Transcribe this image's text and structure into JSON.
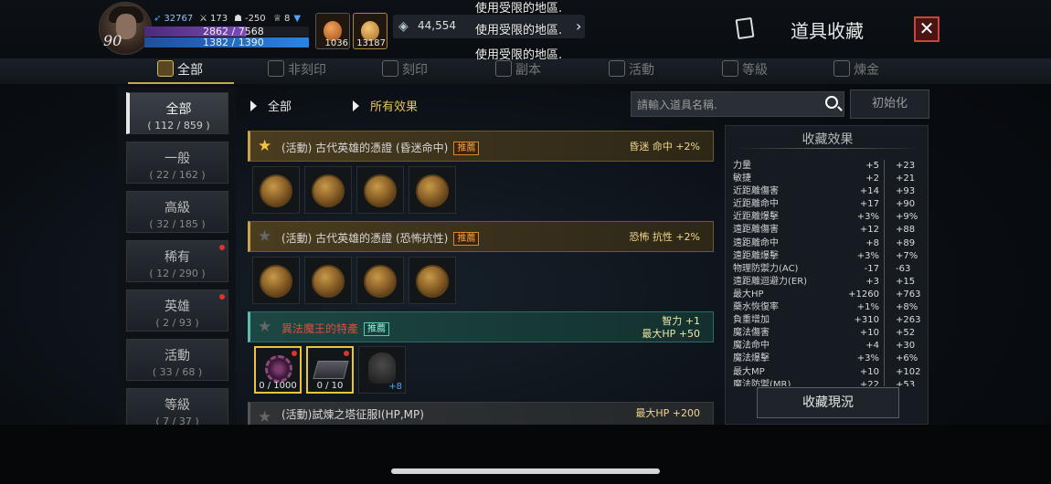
{
  "player": {
    "level": "90",
    "stat_a": "32767",
    "stat_b": "173",
    "stat_c": "-250",
    "stat_d": "8",
    "hp": "2862 / 7568",
    "mp": "1382 / 1390",
    "hp_fill": 0.378,
    "mp_fill": 0.994,
    "potion_count": "1036",
    "food_count": "13187",
    "currency": "44,554"
  },
  "restricted_messages": [
    "使用受限的地區.",
    "使用受限的地區.",
    "使用受限的地區."
  ],
  "window": {
    "title": "道具收藏",
    "close": "✕"
  },
  "tabs": [
    {
      "label": "全部",
      "active": true
    },
    {
      "label": "非刻印",
      "active": false
    },
    {
      "label": "刻印",
      "active": false
    },
    {
      "label": "副本",
      "active": false
    },
    {
      "label": "活動",
      "active": false
    },
    {
      "label": "等級",
      "active": false
    },
    {
      "label": "煉金",
      "active": false
    }
  ],
  "sidebar": [
    {
      "name": "全部",
      "count": "( 112 / 859 )",
      "active": true,
      "dot": false
    },
    {
      "name": "一般",
      "count": "( 22 / 162 )",
      "active": false,
      "dot": false
    },
    {
      "name": "高級",
      "count": "( 32 / 185 )",
      "active": false,
      "dot": false
    },
    {
      "name": "稀有",
      "count": "( 12 / 290 )",
      "active": false,
      "dot": true
    },
    {
      "name": "英雄",
      "count": "( 2 / 93 )",
      "active": false,
      "dot": true
    },
    {
      "name": "活動",
      "count": "( 33 / 68 )",
      "active": false,
      "dot": false
    },
    {
      "name": "等級",
      "count": "( 7 / 37 )",
      "active": false,
      "dot": false
    }
  ],
  "filters": {
    "category": "全部",
    "effect": "所有效果"
  },
  "search": {
    "placeholder": "請輸入道具名稱."
  },
  "reset_label": "初始化",
  "recommend_label": "推薦",
  "sets": [
    {
      "name": "(活動) 古代英雄的憑證 (昏迷命中)",
      "effects": [
        "昏迷 命中 +2%"
      ],
      "starred": true,
      "style": "gold"
    },
    {
      "name": "(活動) 古代英雄的憑證 (恐怖抗性)",
      "effects": [
        "恐怖 抗性 +2%"
      ],
      "starred": false,
      "style": "gold"
    },
    {
      "name": "異法魔王的特產",
      "effects": [
        "智力 +1",
        "最大HP +50"
      ],
      "starred": false,
      "style": "green"
    },
    {
      "name": "(活動)試煉之塔征服I(HP,MP)",
      "effects": [
        "最大HP +200"
      ],
      "starred": false,
      "style": "gray"
    }
  ],
  "set3_items": [
    {
      "qty": "0 / 1000"
    },
    {
      "qty": "0 / 10"
    },
    {
      "plus": "+8"
    }
  ],
  "collection_effects": {
    "title": "收藏效果",
    "rows": [
      {
        "stat": "力量",
        "a": "+5",
        "b": "+23"
      },
      {
        "stat": "敏捷",
        "a": "+2",
        "b": "+21"
      },
      {
        "stat": "近距離傷害",
        "a": "+14",
        "b": "+93"
      },
      {
        "stat": "近距離命中",
        "a": "+17",
        "b": "+90"
      },
      {
        "stat": "近距離爆擊",
        "a": "+3%",
        "b": "+9%"
      },
      {
        "stat": "遠距離傷害",
        "a": "+12",
        "b": "+88"
      },
      {
        "stat": "遠距離命中",
        "a": "+8",
        "b": "+89"
      },
      {
        "stat": "遠距離爆擊",
        "a": "+3%",
        "b": "+7%"
      },
      {
        "stat": "物理防禦力(AC)",
        "a": "-17",
        "b": "-63"
      },
      {
        "stat": "遠距離迴避力(ER)",
        "a": "+3",
        "b": "+15"
      },
      {
        "stat": "最大HP",
        "a": "+1260",
        "b": "+763"
      },
      {
        "stat": "藥水恢復率",
        "a": "+1%",
        "b": "+8%"
      },
      {
        "stat": "負重增加",
        "a": "+310",
        "b": "+263"
      },
      {
        "stat": "魔法傷害",
        "a": "+10",
        "b": "+52"
      },
      {
        "stat": "魔法命中",
        "a": "+4",
        "b": "+30"
      },
      {
        "stat": "魔法爆擊",
        "a": "+3%",
        "b": "+6%"
      },
      {
        "stat": "最大MP",
        "a": "+10",
        "b": "+102"
      },
      {
        "stat": "魔法防禦(MR)",
        "a": "+22",
        "b": "+53"
      }
    ],
    "button": "收藏現況"
  },
  "colors": {
    "accent_gold": "#c7a552",
    "close_red": "#c8453a",
    "notice_red": "#e0322a"
  }
}
